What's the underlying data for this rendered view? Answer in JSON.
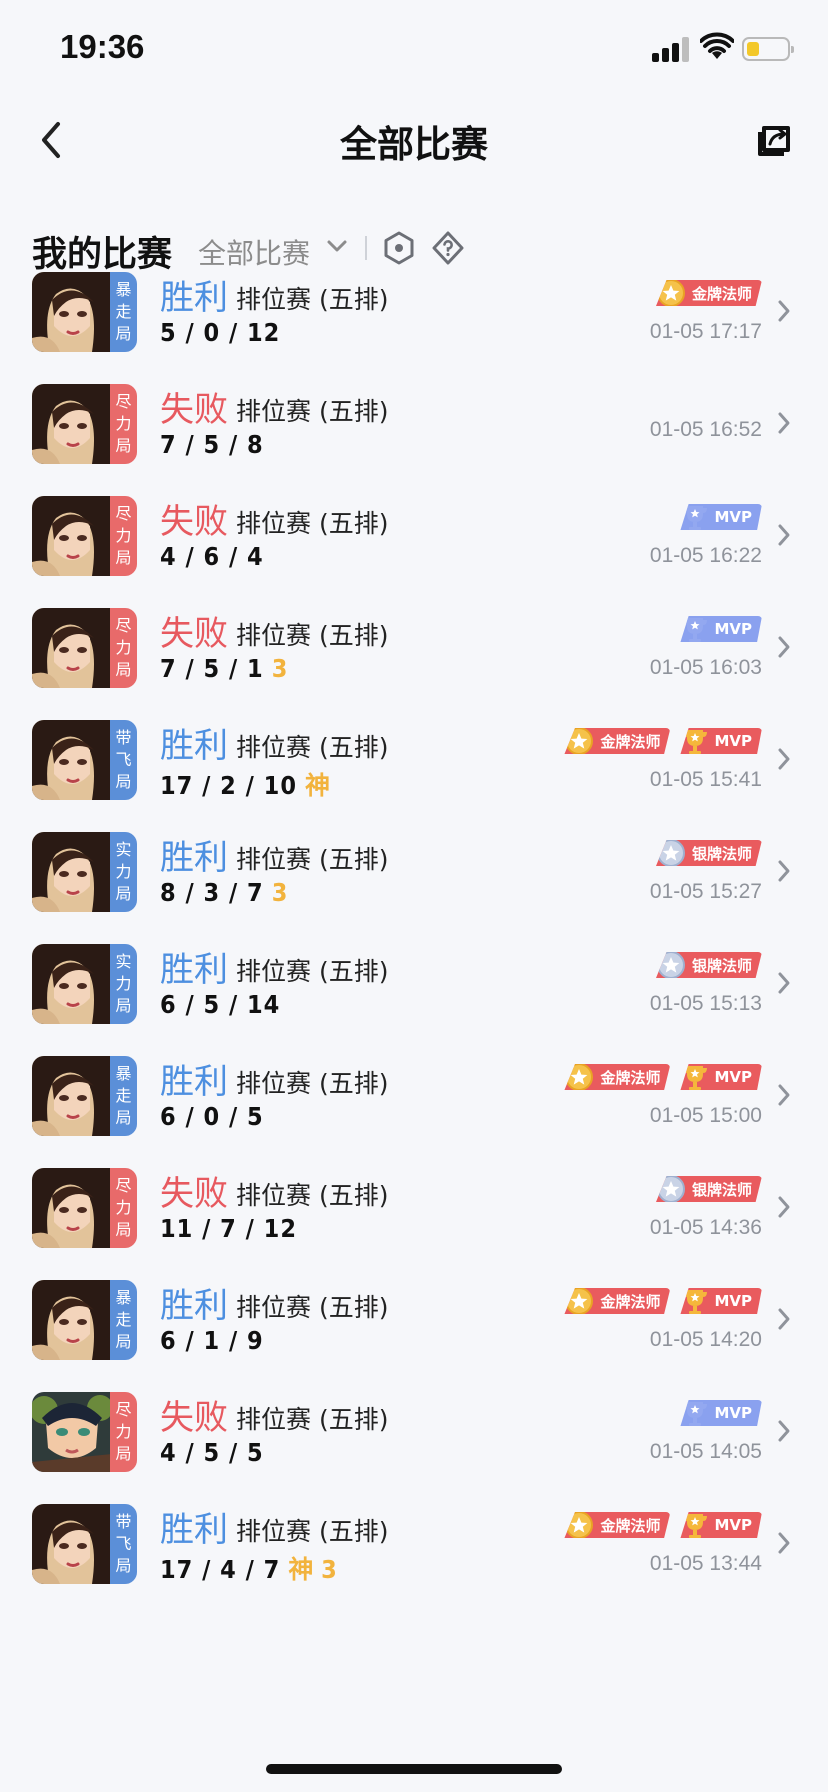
{
  "status_bar": {
    "time": "19:36"
  },
  "nav": {
    "title": "全部比赛"
  },
  "filter": {
    "heading": "我的比赛",
    "scope": "全部比赛"
  },
  "matches": [
    {
      "result": "胜利",
      "outcome": "win",
      "mode": "排位赛 (五排)",
      "kda": "5 / 0 / 12",
      "extra": "",
      "tag": [
        "暴",
        "走",
        "局"
      ],
      "tag_color": "blue",
      "badges": [
        "金牌法师"
      ],
      "time": "01-05 17:17",
      "hero": "a"
    },
    {
      "result": "失败",
      "outcome": "lose",
      "mode": "排位赛 (五排)",
      "kda": "7 / 5 / 8",
      "extra": "",
      "tag": [
        "尽",
        "力",
        "局"
      ],
      "tag_color": "red",
      "badges": [],
      "time": "01-05 16:52",
      "hero": "a"
    },
    {
      "result": "失败",
      "outcome": "lose",
      "mode": "排位赛 (五排)",
      "kda": "4 / 6 / 4",
      "extra": "",
      "tag": [
        "尽",
        "力",
        "局"
      ],
      "tag_color": "red",
      "badges": [
        "MVP"
      ],
      "time": "01-05 16:22",
      "hero": "a"
    },
    {
      "result": "失败",
      "outcome": "lose",
      "mode": "排位赛 (五排)",
      "kda": "7 / 5 / 1",
      "extra": "3",
      "tag": [
        "尽",
        "力",
        "局"
      ],
      "tag_color": "red",
      "badges": [
        "MVP"
      ],
      "time": "01-05 16:03",
      "hero": "a"
    },
    {
      "result": "胜利",
      "outcome": "win",
      "mode": "排位赛 (五排)",
      "kda": "17 / 2 / 10",
      "extra": "神",
      "tag": [
        "带",
        "飞",
        "局"
      ],
      "tag_color": "blue",
      "badges": [
        "金牌法师",
        "MVP"
      ],
      "time": "01-05 15:41",
      "hero": "a"
    },
    {
      "result": "胜利",
      "outcome": "win",
      "mode": "排位赛 (五排)",
      "kda": "8 / 3 / 7",
      "extra": "3",
      "tag": [
        "实",
        "力",
        "局"
      ],
      "tag_color": "blue",
      "badges": [
        "银牌法师"
      ],
      "time": "01-05 15:27",
      "hero": "a"
    },
    {
      "result": "胜利",
      "outcome": "win",
      "mode": "排位赛 (五排)",
      "kda": "6 / 5 / 14",
      "extra": "",
      "tag": [
        "实",
        "力",
        "局"
      ],
      "tag_color": "blue",
      "badges": [
        "银牌法师"
      ],
      "time": "01-05 15:13",
      "hero": "a"
    },
    {
      "result": "胜利",
      "outcome": "win",
      "mode": "排位赛 (五排)",
      "kda": "6 / 0 / 5",
      "extra": "",
      "tag": [
        "暴",
        "走",
        "局"
      ],
      "tag_color": "blue",
      "badges": [
        "金牌法师",
        "MVP"
      ],
      "time": "01-05 15:00",
      "hero": "a"
    },
    {
      "result": "失败",
      "outcome": "lose",
      "mode": "排位赛 (五排)",
      "kda": "11 / 7 / 12",
      "extra": "",
      "tag": [
        "尽",
        "力",
        "局"
      ],
      "tag_color": "red",
      "badges": [
        "银牌法师"
      ],
      "time": "01-05 14:36",
      "hero": "a"
    },
    {
      "result": "胜利",
      "outcome": "win",
      "mode": "排位赛 (五排)",
      "kda": "6 / 1 / 9",
      "extra": "",
      "tag": [
        "暴",
        "走",
        "局"
      ],
      "tag_color": "blue",
      "badges": [
        "金牌法师",
        "MVP"
      ],
      "time": "01-05 14:20",
      "hero": "a"
    },
    {
      "result": "失败",
      "outcome": "lose",
      "mode": "排位赛 (五排)",
      "kda": "4 / 5 / 5",
      "extra": "",
      "tag": [
        "尽",
        "力",
        "局"
      ],
      "tag_color": "red",
      "badges": [
        "MVP"
      ],
      "time": "01-05 14:05",
      "hero": "b"
    },
    {
      "result": "胜利",
      "outcome": "win",
      "mode": "排位赛 (五排)",
      "kda": "17 / 4 / 7",
      "extra": "神 3",
      "tag": [
        "带",
        "飞",
        "局"
      ],
      "tag_color": "blue",
      "badges": [
        "金牌法师",
        "MVP"
      ],
      "time": "01-05 13:44",
      "hero": "a"
    }
  ],
  "colors": {
    "win": "#4d8fe0",
    "lose": "#e7595f",
    "badge_red": "#e95b5e",
    "mvp_blue": "#8aa1ef",
    "extra": "#f2b33d"
  },
  "icons": {
    "back": "chevron-left-icon",
    "share": "share-icon",
    "filter_chevron": "chevron-down-icon",
    "hex": "hexagon-icon",
    "help": "help-diamond-icon",
    "row_arrow": "chevron-right-icon"
  }
}
